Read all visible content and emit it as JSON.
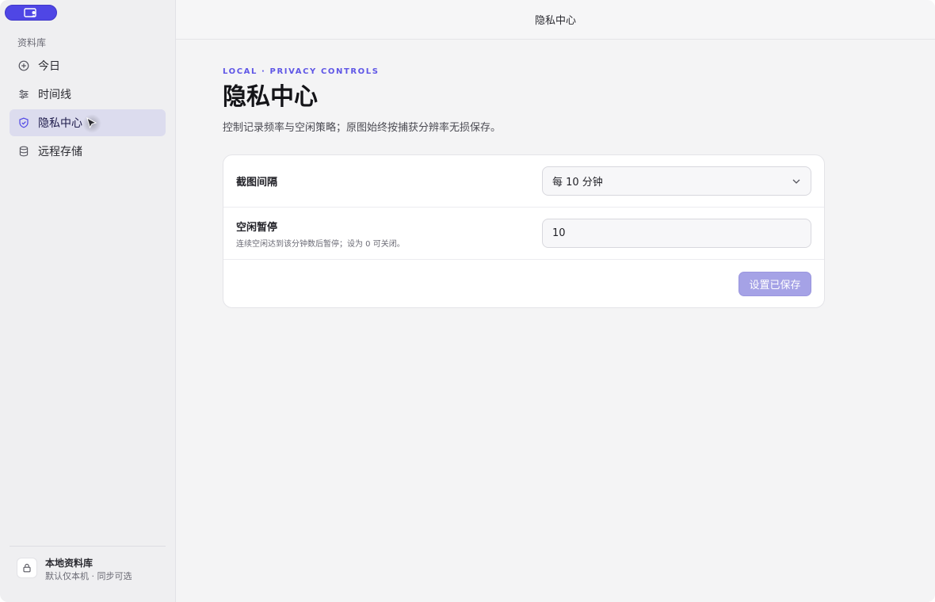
{
  "sidebar": {
    "section_label": "资料库",
    "items": [
      {
        "label": "今日",
        "icon": "plus-circle-icon",
        "active": false
      },
      {
        "label": "时间线",
        "icon": "sliders-icon",
        "active": false
      },
      {
        "label": "隐私中心",
        "icon": "shield-check-icon",
        "active": true
      },
      {
        "label": "远程存储",
        "icon": "database-icon",
        "active": false
      }
    ],
    "bottom": {
      "title": "本地资料库",
      "subtitle": "默认仅本机 · 同步可选",
      "icon": "lock-icon"
    }
  },
  "topbar": {
    "title": "隐私中心"
  },
  "main": {
    "eyebrow": "LOCAL · PRIVACY CONTROLS",
    "title": "隐私中心",
    "description": "控制记录频率与空闲策略；原图始终按捕获分辨率无损保存。",
    "settings": {
      "interval_label": "截图间隔",
      "interval_value": "每 10 分钟",
      "idle_label": "空闲暂停",
      "idle_sub": "连续空闲达到该分钟数后暂停；设为 0 可关闭。",
      "idle_value": "10",
      "save_label": "设置已保存"
    }
  },
  "colors": {
    "accent": "#4f46e5",
    "active_nav_bg": "#dcdcee",
    "save_button_disabled": "#a5a2e6"
  }
}
